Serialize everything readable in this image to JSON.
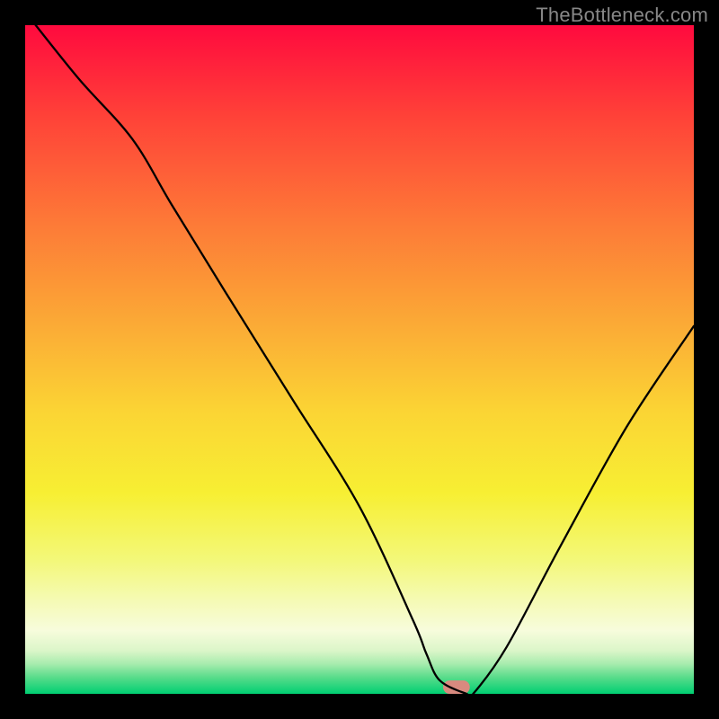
{
  "watermark": "TheBottleneck.com",
  "chart_data": {
    "type": "line",
    "title": "",
    "xlabel": "",
    "ylabel": "",
    "xlim": [
      0,
      100
    ],
    "ylim": [
      0,
      100
    ],
    "x": [
      0,
      8,
      16,
      22,
      30,
      40,
      50,
      58,
      60,
      62,
      66,
      67,
      72,
      80,
      90,
      100
    ],
    "values": [
      102,
      92,
      83,
      73,
      60,
      44,
      28,
      11,
      6,
      2,
      0,
      0,
      7,
      22,
      40,
      55
    ],
    "marker": {
      "x_start": 62.5,
      "x_end": 66.5,
      "height": 2.0,
      "color": "#D88A7F"
    },
    "gradient_stops": [
      {
        "offset": 0.0,
        "color": "#FF0A3E"
      },
      {
        "offset": 0.14,
        "color": "#FF4338"
      },
      {
        "offset": 0.3,
        "color": "#FD7B37"
      },
      {
        "offset": 0.45,
        "color": "#FBAB36"
      },
      {
        "offset": 0.58,
        "color": "#FBD534"
      },
      {
        "offset": 0.7,
        "color": "#F7EF33"
      },
      {
        "offset": 0.8,
        "color": "#F3F879"
      },
      {
        "offset": 0.86,
        "color": "#F5FAB4"
      },
      {
        "offset": 0.905,
        "color": "#F7FCDC"
      },
      {
        "offset": 0.935,
        "color": "#DCF6C9"
      },
      {
        "offset": 0.955,
        "color": "#A8ECAE"
      },
      {
        "offset": 0.975,
        "color": "#5ADC8B"
      },
      {
        "offset": 1.0,
        "color": "#00CF72"
      }
    ],
    "line_color": "#000000",
    "line_width": 2.3
  }
}
